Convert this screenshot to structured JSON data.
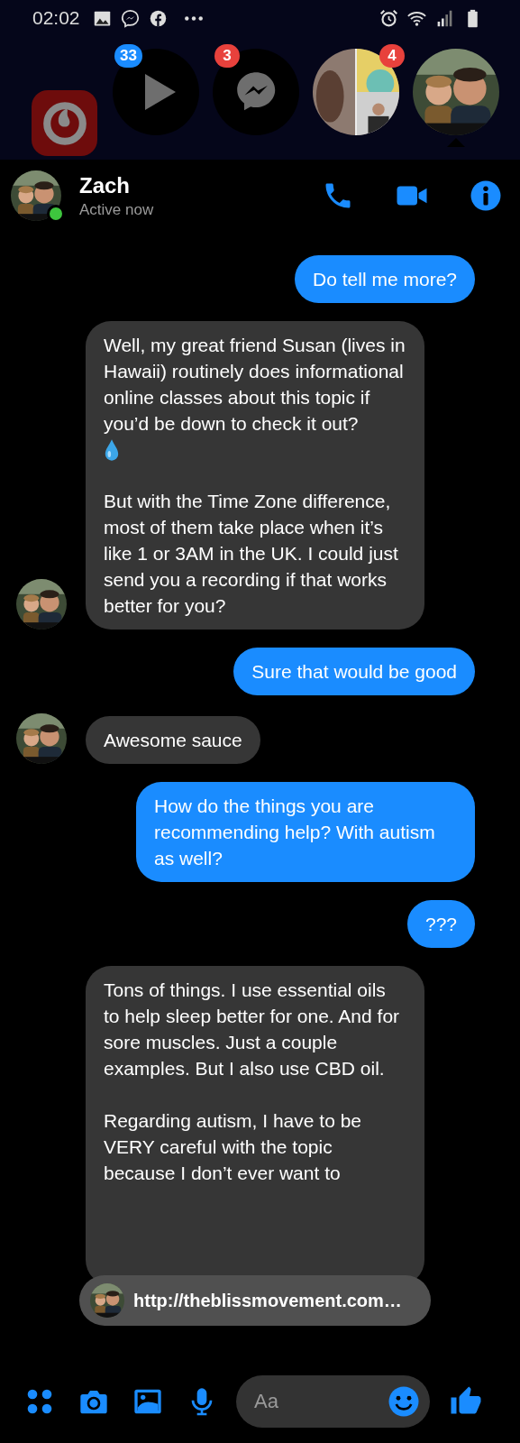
{
  "status_bar": {
    "time": "02:02"
  },
  "chat_heads": [
    {
      "kind": "app"
    },
    {
      "kind": "play",
      "badge": "33",
      "color": "#1a8cff"
    },
    {
      "kind": "messenger",
      "badge": "3",
      "color": "#e8413c"
    },
    {
      "badge": "4",
      "color": "#e8413c"
    },
    {
      "kind": "contact"
    }
  ],
  "header": {
    "name": "Zach",
    "status": "Active now",
    "online": true
  },
  "messages": [
    {
      "kind": "outgoing",
      "parts": [
        {
          "kind": "text",
          "text": "Do tell me more?"
        }
      ]
    },
    {
      "kind": "incoming",
      "avatar": true,
      "parts": [
        {
          "kind": "text",
          "text": "Well, my great friend Susan (lives in Hawaii) routinely does informational online classes about this topic if you’d be down to check it out?"
        },
        {
          "kind": "droplet"
        },
        {
          "kind": "text",
          "text": "But with the Time Zone difference, most of them take place when it’s like 1 or 3AM in the UK. I could just send you a recording if that works better for you?"
        }
      ]
    },
    {
      "kind": "outgoing",
      "parts": [
        {
          "kind": "text",
          "text": "Sure that would be good"
        }
      ]
    },
    {
      "kind": "incoming",
      "avatar": true,
      "parts": [
        {
          "kind": "text",
          "text": "Awesome sauce"
        }
      ]
    },
    {
      "kind": "outgoing",
      "parts": [
        {
          "kind": "text",
          "text": "How do the things you are recommending help? With autism as well?"
        }
      ]
    },
    {
      "kind": "outgoing",
      "parts": [
        {
          "kind": "text",
          "text": "???"
        }
      ]
    },
    {
      "kind": "incoming",
      "avatar": false,
      "parts": [
        {
          "kind": "text",
          "text": "Tons of things. I use essential oils to help sleep better for one. And for sore muscles. Just a couple examples. But I also use CBD oil."
        },
        {
          "kind": "text",
          "text": "Regarding autism, I have to be VERY careful with the topic because I don’t ever want to"
        }
      ]
    }
  ],
  "link_preview": {
    "url": "http://theblissmovement.com…"
  },
  "composer": {
    "placeholder": "Aa"
  }
}
